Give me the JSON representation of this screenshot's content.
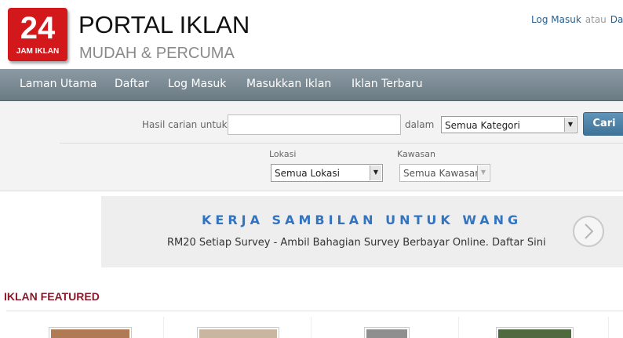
{
  "header": {
    "logo_number": "24",
    "logo_sub": "JAM IKLAN",
    "title": "PORTAL IKLAN",
    "tagline": "MUDAH & PERCUMA",
    "login_link": "Log Masuk",
    "separator": "atau",
    "register_link": "Daftar",
    "brand_color": "#d3181b"
  },
  "nav": {
    "items": [
      "Laman Utama",
      "Daftar",
      "Log Masuk",
      "Masukkan Iklan",
      "Iklan Terbaru"
    ]
  },
  "search": {
    "query_label": "Hasil carian untuk",
    "query_value": "",
    "in_label": "dalam",
    "category_selected": "Semua Kategori",
    "button_label": "Cari",
    "location_label": "Lokasi",
    "location_selected": "Semua Lokasi",
    "area_label": "Kawasan",
    "area_selected": "Semua Kawasan"
  },
  "banner": {
    "headline": "KERJA SAMBILAN UNTUK WANG",
    "subtext": "RM20 Setiap Survey - Ambil Bahagian Survey Berbayar Online. Daftar Sini",
    "arrow_icon": "chevron-right-icon"
  },
  "featured": {
    "title": "IKLAN FEATURED",
    "items": [
      {
        "icon": "product-photo",
        "color": "#b07a55"
      },
      {
        "icon": "product-photo",
        "color": "#c9b6a0"
      },
      {
        "icon": "product-photo",
        "color": "#8f8f8f"
      },
      {
        "icon": "product-photo",
        "color": "#4f6a3e"
      }
    ]
  }
}
